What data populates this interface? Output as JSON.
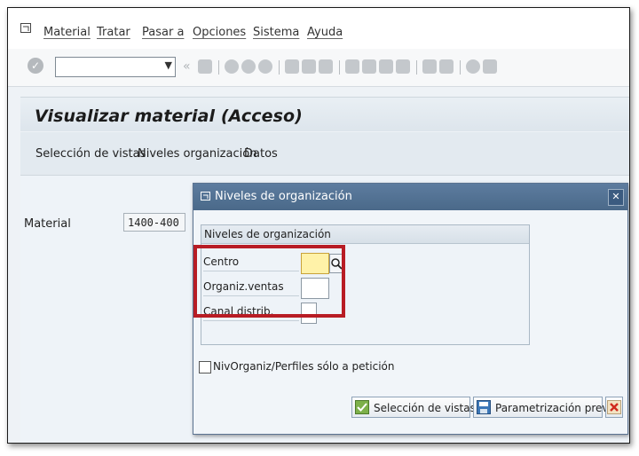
{
  "menu": {
    "items": [
      "Material",
      "Tratar",
      "Pasar a",
      "Opciones",
      "Sistema",
      "Ayuda"
    ]
  },
  "toolbar": {
    "command_field_value": "",
    "icons": [
      "enter-icon",
      "save-icon",
      "back-icon",
      "exit-icon",
      "cancel-icon",
      "print-icon",
      "find-icon",
      "find-next-icon",
      "first-page-icon",
      "previous-page-icon",
      "next-page-icon",
      "last-page-icon",
      "new-session-icon",
      "shortcut-icon",
      "help-icon",
      "layout-icon"
    ]
  },
  "page": {
    "title": "Visualizar material (Acceso)"
  },
  "app_toolbar": {
    "buttons": [
      "Selección de vistas",
      "Niveles organización",
      "Datos"
    ]
  },
  "form": {
    "material_label": "Material",
    "material_value": "1400-400"
  },
  "dialog": {
    "title": "Niveles de organización",
    "group_title": "Niveles de organización",
    "fields": [
      {
        "label": "Centro",
        "value": ""
      },
      {
        "label": "Organiz.ventas",
        "value": ""
      },
      {
        "label": "Canal distrib.",
        "value": ""
      }
    ],
    "checkbox_label": "NivOrganiz/Perfiles sólo a petición",
    "checkbox_checked": false,
    "buttons": {
      "select_views": "Selección de vistas",
      "default_values": "Parametrización previa"
    }
  },
  "colors": {
    "dialog_title_bg": "#4a6989",
    "highlight_border": "#b81c24",
    "focus_field": "#fff2a8"
  }
}
